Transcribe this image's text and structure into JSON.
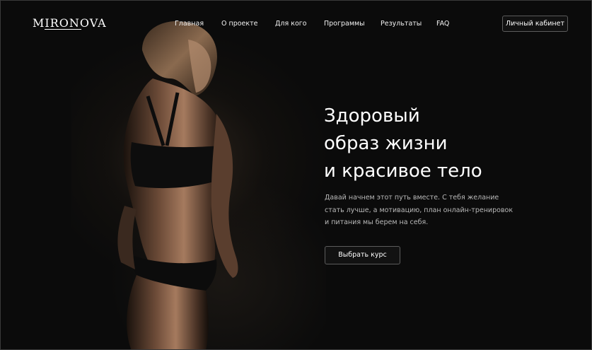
{
  "brand": {
    "logo_text": "MIRONOVA"
  },
  "nav": {
    "items": [
      {
        "label": "Главная"
      },
      {
        "label": "О проекте"
      },
      {
        "label": "Для кого"
      },
      {
        "label": "Программы"
      },
      {
        "label": "Результаты"
      },
      {
        "label": "FAQ"
      }
    ]
  },
  "header": {
    "cabinet_label": "Личный кабинет"
  },
  "hero": {
    "title_lines": [
      "Здоровый",
      "образ жизни",
      "и красивое тело"
    ],
    "text_lines": [
      "Давай начнем этот путь вместе. С тебя желание",
      "стать лучше, а мотивацию, план онлайн-тренировок",
      "и питания мы берем на себя."
    ],
    "cta_label": "Выбрать курс",
    "image": "woman-silhouette-photo"
  },
  "colors": {
    "background": "#0b0b0b",
    "text": "#ffffff",
    "muted_text": "#b9b9b9",
    "button_border": "#5c5c5c"
  }
}
